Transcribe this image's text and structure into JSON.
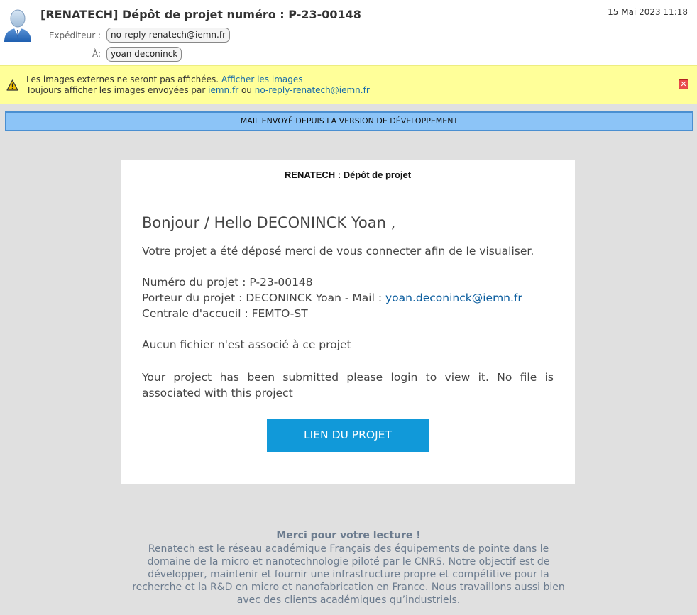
{
  "header": {
    "subject": "[RENATECH] Dépôt de projet numéro : P-23-00148",
    "date": "15 Mai 2023 11:18",
    "from_label": "Expéditeur :",
    "from": "no-reply-renatech@iemn.fr",
    "to_label": "À:",
    "to": "yoan deconinck"
  },
  "warning": {
    "line1_text": "Les images externes ne seront pas affichées.",
    "line1_link": "Afficher les images",
    "line2_text": "Toujours afficher les images envoyées par",
    "line2_link1": "iemn.fr",
    "line2_or": "ou",
    "line2_link2": "no-reply-renatech@iemn.fr",
    "close": "✕"
  },
  "dev_banner": "MAIL ENVOYÉ DEPUIS LA VERSION DE DÉVELOPPEMENT",
  "card": {
    "title": "RENATECH : Dépôt de projet",
    "greeting": "Bonjour / Hello DECONINCK Yoan ,",
    "intro": "Votre projet a été déposé merci de vous connecter afin de le visualiser.",
    "project_number": "Numéro du projet : P-23-00148",
    "owner_prefix": "Porteur du projet : DECONINCK Yoan - Mail : ",
    "owner_email": "yoan.deconinck@iemn.fr",
    "centrale": "Centrale d'accueil : FEMTO-ST",
    "no_file": "Aucun fichier n'est associé à ce projet",
    "english": "Your project has been submitted please login to view it. No file is associated with this project",
    "button": "LIEN DU PROJET"
  },
  "footer": {
    "title": "Merci pour votre lecture !",
    "text": "Renatech est le réseau académique Français des équipements de pointe dans le domaine de la micro et nanotechnologie piloté par le CNRS. Notre objectif est de développer, maintenir et fournir une infrastructure propre et compétitive pour la recherche et la R&D en micro et nanofabrication en France. Nous travaillons aussi bien avec des clients académiques qu’industriels."
  }
}
